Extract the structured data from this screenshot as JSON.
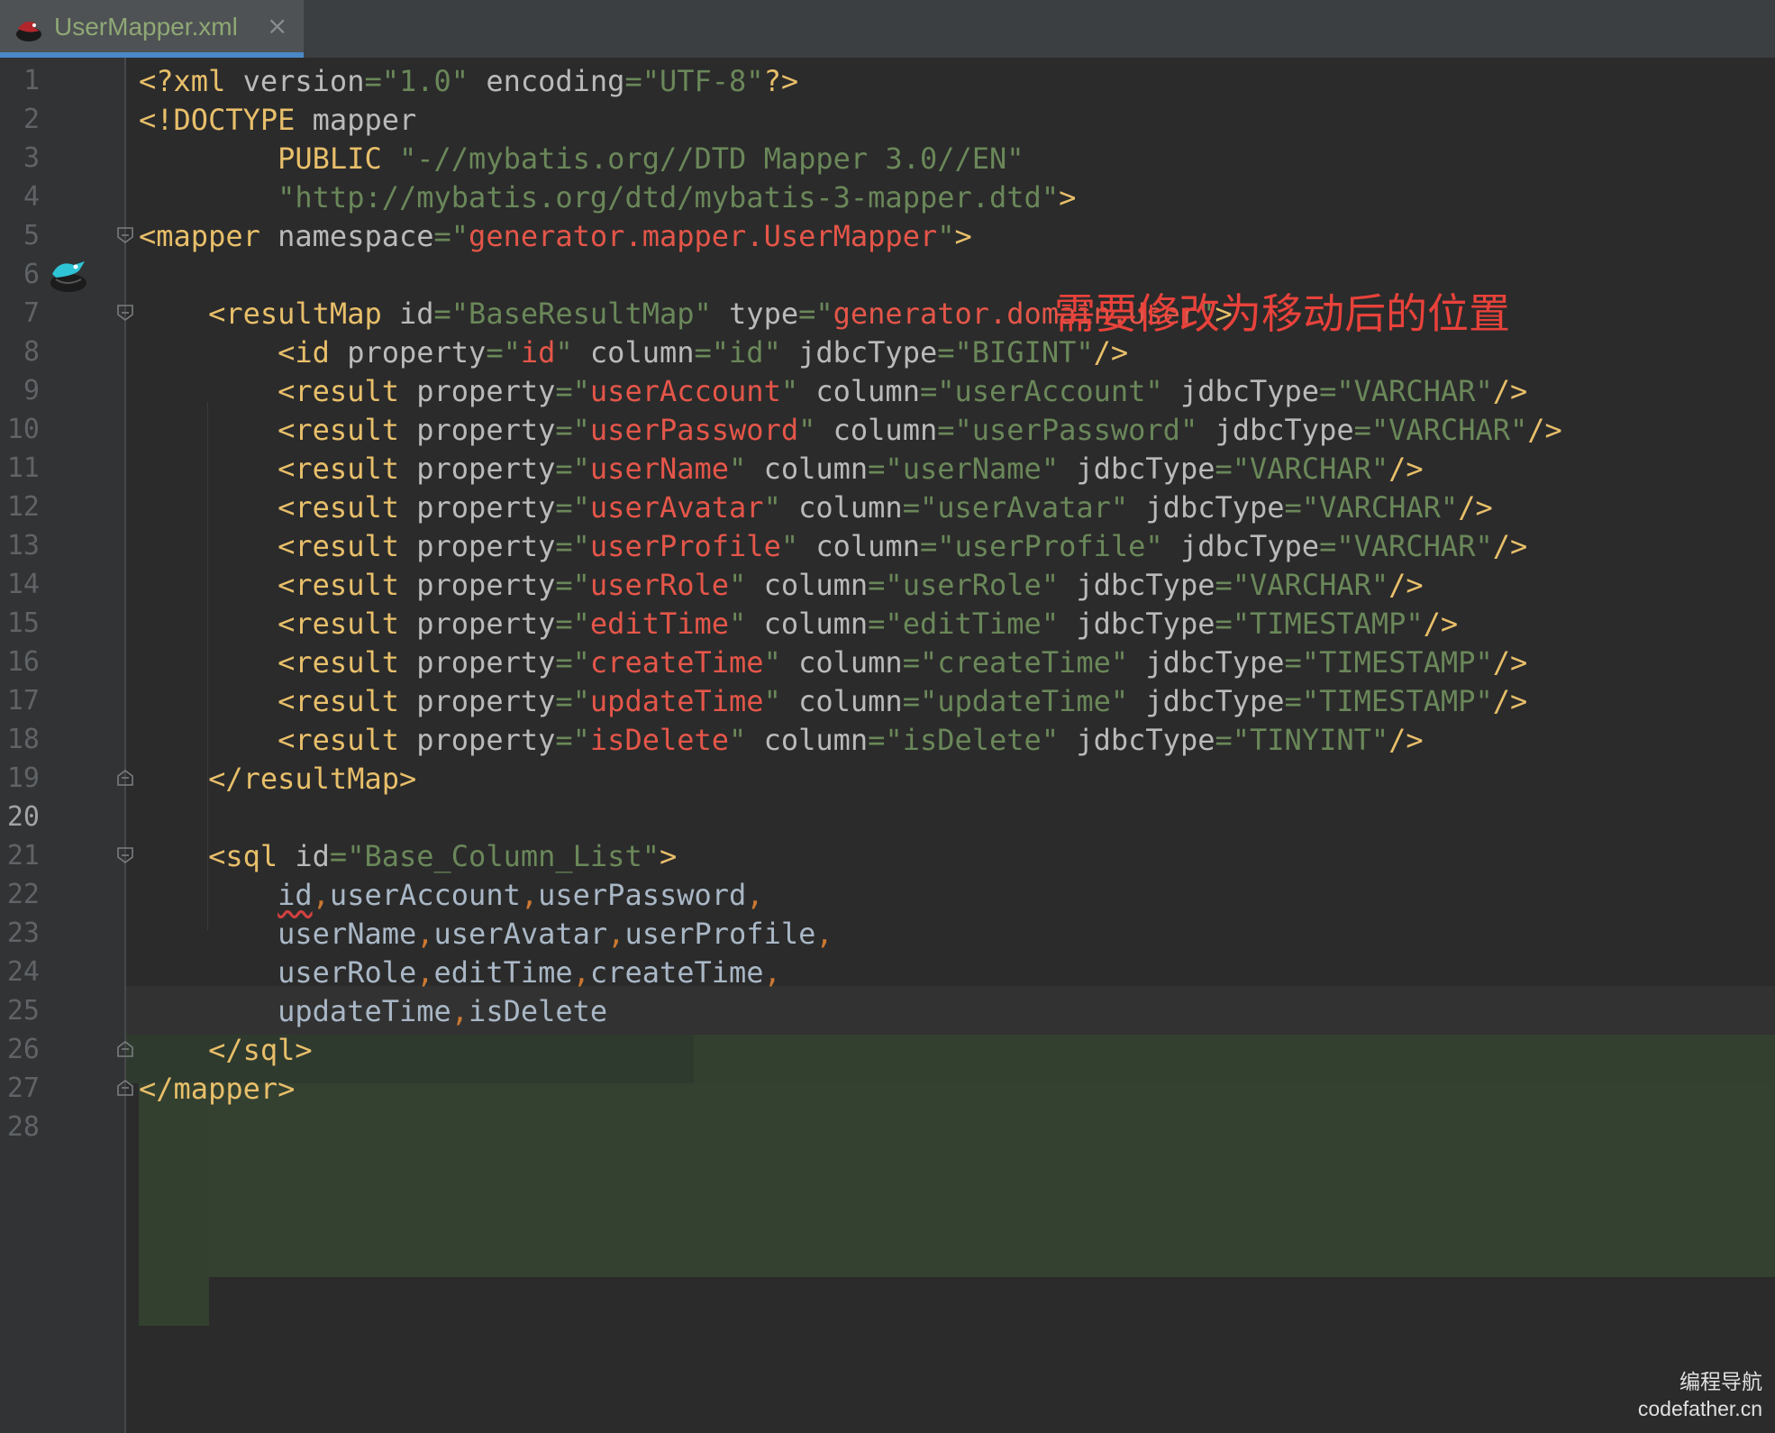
{
  "tab": {
    "filename": "UserMapper.xml",
    "close_icon": "×",
    "file_icon": "mybatis-bird-icon"
  },
  "annotation": "需要修改为移动后的位置",
  "watermark": {
    "line1": "编程导航",
    "line2": "codefather.cn"
  },
  "current_line": 20,
  "line_numbers": [
    "1",
    "2",
    "3",
    "4",
    "5",
    "6",
    "7",
    "8",
    "9",
    "10",
    "11",
    "12",
    "13",
    "14",
    "15",
    "16",
    "17",
    "18",
    "19",
    "20",
    "21",
    "22",
    "23",
    "24",
    "25",
    "26",
    "27",
    "28"
  ],
  "lines": [
    [
      [
        "t",
        "<?xml "
      ],
      [
        "a",
        "version"
      ],
      [
        "q",
        "=\""
      ],
      [
        "q",
        "1.0"
      ],
      [
        "q",
        "\" "
      ],
      [
        "a",
        "encoding"
      ],
      [
        "q",
        "=\""
      ],
      [
        "q",
        "UTF-8"
      ],
      [
        "q",
        "\""
      ],
      [
        "t",
        "?>"
      ]
    ],
    [
      [
        "t",
        "<!DOCTYPE "
      ],
      [
        "a",
        "mapper"
      ]
    ],
    [
      [
        "v",
        "        "
      ],
      [
        "t",
        "PUBLIC "
      ],
      [
        "q",
        "\"-//mybatis.org//DTD Mapper 3.0//EN\""
      ]
    ],
    [
      [
        "v",
        "        "
      ],
      [
        "q",
        "\"http://mybatis.org/dtd/mybatis-3-mapper.dtd\""
      ],
      [
        "t",
        ">"
      ]
    ],
    [
      [
        "t",
        "<mapper "
      ],
      [
        "a",
        "namespace"
      ],
      [
        "q",
        "=\""
      ],
      [
        "r",
        "generator.mapper.UserMapper"
      ],
      [
        "q",
        "\""
      ],
      [
        "t",
        ">"
      ]
    ],
    [],
    [
      [
        "v",
        "    "
      ],
      [
        "t",
        "<resultMap "
      ],
      [
        "a",
        "id"
      ],
      [
        "q",
        "=\"BaseResultMap\" "
      ],
      [
        "a",
        "type"
      ],
      [
        "q",
        "=\""
      ],
      [
        "r",
        "generator.domain.User"
      ],
      [
        "q",
        "\""
      ],
      [
        "t",
        ">"
      ]
    ],
    [
      [
        "v",
        "        "
      ],
      [
        "t",
        "<id "
      ],
      [
        "a",
        "property"
      ],
      [
        "q",
        "=\""
      ],
      [
        "r",
        "id"
      ],
      [
        "q",
        "\" "
      ],
      [
        "a",
        "column"
      ],
      [
        "q",
        "=\"id\" "
      ],
      [
        "a",
        "jdbcType"
      ],
      [
        "q",
        "=\"BIGINT\""
      ],
      [
        "t",
        "/>"
      ]
    ],
    [
      [
        "v",
        "        "
      ],
      [
        "t",
        "<result "
      ],
      [
        "a",
        "property"
      ],
      [
        "q",
        "=\""
      ],
      [
        "r",
        "userAccount"
      ],
      [
        "q",
        "\" "
      ],
      [
        "a",
        "column"
      ],
      [
        "q",
        "=\"userAccount\" "
      ],
      [
        "a",
        "jdbcType"
      ],
      [
        "q",
        "=\"VARCHAR\""
      ],
      [
        "t",
        "/>"
      ]
    ],
    [
      [
        "v",
        "        "
      ],
      [
        "t",
        "<result "
      ],
      [
        "a",
        "property"
      ],
      [
        "q",
        "=\""
      ],
      [
        "r",
        "userPassword"
      ],
      [
        "q",
        "\" "
      ],
      [
        "a",
        "column"
      ],
      [
        "q",
        "=\"userPassword\" "
      ],
      [
        "a",
        "jdbcType"
      ],
      [
        "q",
        "=\"VARCHAR\""
      ],
      [
        "t",
        "/>"
      ]
    ],
    [
      [
        "v",
        "        "
      ],
      [
        "t",
        "<result "
      ],
      [
        "a",
        "property"
      ],
      [
        "q",
        "=\""
      ],
      [
        "r",
        "userName"
      ],
      [
        "q",
        "\" "
      ],
      [
        "a",
        "column"
      ],
      [
        "q",
        "=\"userName\" "
      ],
      [
        "a",
        "jdbcType"
      ],
      [
        "q",
        "=\"VARCHAR\""
      ],
      [
        "t",
        "/>"
      ]
    ],
    [
      [
        "v",
        "        "
      ],
      [
        "t",
        "<result "
      ],
      [
        "a",
        "property"
      ],
      [
        "q",
        "=\""
      ],
      [
        "r",
        "userAvatar"
      ],
      [
        "q",
        "\" "
      ],
      [
        "a",
        "column"
      ],
      [
        "q",
        "=\"userAvatar\" "
      ],
      [
        "a",
        "jdbcType"
      ],
      [
        "q",
        "=\"VARCHAR\""
      ],
      [
        "t",
        "/>"
      ]
    ],
    [
      [
        "v",
        "        "
      ],
      [
        "t",
        "<result "
      ],
      [
        "a",
        "property"
      ],
      [
        "q",
        "=\""
      ],
      [
        "r",
        "userProfile"
      ],
      [
        "q",
        "\" "
      ],
      [
        "a",
        "column"
      ],
      [
        "q",
        "=\"userProfile\" "
      ],
      [
        "a",
        "jdbcType"
      ],
      [
        "q",
        "=\"VARCHAR\""
      ],
      [
        "t",
        "/>"
      ]
    ],
    [
      [
        "v",
        "        "
      ],
      [
        "t",
        "<result "
      ],
      [
        "a",
        "property"
      ],
      [
        "q",
        "=\""
      ],
      [
        "r",
        "userRole"
      ],
      [
        "q",
        "\" "
      ],
      [
        "a",
        "column"
      ],
      [
        "q",
        "=\"userRole\" "
      ],
      [
        "a",
        "jdbcType"
      ],
      [
        "q",
        "=\"VARCHAR\""
      ],
      [
        "t",
        "/>"
      ]
    ],
    [
      [
        "v",
        "        "
      ],
      [
        "t",
        "<result "
      ],
      [
        "a",
        "property"
      ],
      [
        "q",
        "=\""
      ],
      [
        "r",
        "editTime"
      ],
      [
        "q",
        "\" "
      ],
      [
        "a",
        "column"
      ],
      [
        "q",
        "=\"editTime\" "
      ],
      [
        "a",
        "jdbcType"
      ],
      [
        "q",
        "=\"TIMESTAMP\""
      ],
      [
        "t",
        "/>"
      ]
    ],
    [
      [
        "v",
        "        "
      ],
      [
        "t",
        "<result "
      ],
      [
        "a",
        "property"
      ],
      [
        "q",
        "=\""
      ],
      [
        "r",
        "createTime"
      ],
      [
        "q",
        "\" "
      ],
      [
        "a",
        "column"
      ],
      [
        "q",
        "=\"createTime\" "
      ],
      [
        "a",
        "jdbcType"
      ],
      [
        "q",
        "=\"TIMESTAMP\""
      ],
      [
        "t",
        "/>"
      ]
    ],
    [
      [
        "v",
        "        "
      ],
      [
        "t",
        "<result "
      ],
      [
        "a",
        "property"
      ],
      [
        "q",
        "=\""
      ],
      [
        "r",
        "updateTime"
      ],
      [
        "q",
        "\" "
      ],
      [
        "a",
        "column"
      ],
      [
        "q",
        "=\"updateTime\" "
      ],
      [
        "a",
        "jdbcType"
      ],
      [
        "q",
        "=\"TIMESTAMP\""
      ],
      [
        "t",
        "/>"
      ]
    ],
    [
      [
        "v",
        "        "
      ],
      [
        "t",
        "<result "
      ],
      [
        "a",
        "property"
      ],
      [
        "q",
        "=\""
      ],
      [
        "r",
        "isDelete"
      ],
      [
        "q",
        "\" "
      ],
      [
        "a",
        "column"
      ],
      [
        "q",
        "=\"isDelete\" "
      ],
      [
        "a",
        "jdbcType"
      ],
      [
        "q",
        "=\"TINYINT\""
      ],
      [
        "t",
        "/>"
      ]
    ],
    [
      [
        "v",
        "    "
      ],
      [
        "t",
        "</resultMap>"
      ]
    ],
    [],
    [
      [
        "v",
        "    "
      ],
      [
        "t",
        "<sql "
      ],
      [
        "a",
        "id"
      ],
      [
        "q",
        "=\"Base_Column_List\""
      ],
      [
        "t",
        ">"
      ]
    ],
    [
      [
        "v",
        "        "
      ],
      [
        "squig",
        "id"
      ],
      [
        "p",
        ","
      ],
      [
        "v",
        "userAccount"
      ],
      [
        "p",
        ","
      ],
      [
        "v",
        "userPassword"
      ],
      [
        "p",
        ","
      ]
    ],
    [
      [
        "v",
        "        userName"
      ],
      [
        "p",
        ","
      ],
      [
        "v",
        "userAvatar"
      ],
      [
        "p",
        ","
      ],
      [
        "v",
        "userProfile"
      ],
      [
        "p",
        ","
      ]
    ],
    [
      [
        "v",
        "        userRole"
      ],
      [
        "p",
        ","
      ],
      [
        "v",
        "editTime"
      ],
      [
        "p",
        ","
      ],
      [
        "v",
        "createTime"
      ],
      [
        "p",
        ","
      ]
    ],
    [
      [
        "v",
        "        updateTime"
      ],
      [
        "p",
        ","
      ],
      [
        "v",
        "isDelete"
      ]
    ],
    [
      [
        "v",
        "    "
      ],
      [
        "t",
        "</sql>"
      ]
    ],
    [
      [
        "t",
        "</mapper>"
      ]
    ],
    []
  ],
  "fold_markers": [
    {
      "line": 5,
      "kind": "open"
    },
    {
      "line": 7,
      "kind": "open"
    },
    {
      "line": 19,
      "kind": "close"
    },
    {
      "line": 21,
      "kind": "open"
    },
    {
      "line": 26,
      "kind": "close"
    },
    {
      "line": 27,
      "kind": "close"
    }
  ]
}
